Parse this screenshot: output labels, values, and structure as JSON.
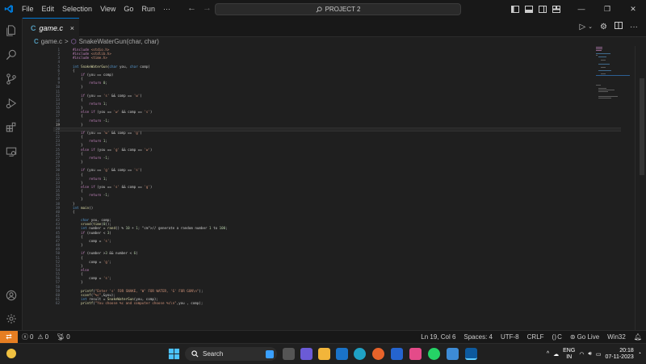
{
  "menu": [
    "File",
    "Edit",
    "Selection",
    "View",
    "Go",
    "Run",
    "···"
  ],
  "search": {
    "label": "PROJECT 2"
  },
  "tab": {
    "filename": "game.c",
    "icon_letter": "C",
    "close": "×"
  },
  "breadcrumb": {
    "file": "game.c",
    "separator": ">",
    "symbol": "SnakeWaterGun(char, char)"
  },
  "code_lines": [
    {
      "n": "1",
      "t": "#include <stdio.h>"
    },
    {
      "n": "2",
      "t": "#include <stdlib.h>"
    },
    {
      "n": "3",
      "t": "#include <time.h>"
    },
    {
      "n": "4",
      "t": ""
    },
    {
      "n": "5",
      "t": "int SnakeWaterGun(char you, char comp)"
    },
    {
      "n": "6",
      "t": "{"
    },
    {
      "n": "7",
      "t": "    if (you == comp)"
    },
    {
      "n": "8",
      "t": "    {"
    },
    {
      "n": "9",
      "t": "        return 0;"
    },
    {
      "n": "10",
      "t": "    }"
    },
    {
      "n": "11",
      "t": ""
    },
    {
      "n": "12",
      "t": "    if (you == 's' && comp == 'w')"
    },
    {
      "n": "13",
      "t": "    {"
    },
    {
      "n": "14",
      "t": "        return 1;"
    },
    {
      "n": "15",
      "t": "    }"
    },
    {
      "n": "16",
      "t": "    else if (you == 'w' && comp == 's')"
    },
    {
      "n": "17",
      "t": "    {"
    },
    {
      "n": "18",
      "t": "        return -1;"
    },
    {
      "n": "19",
      "t": "    }"
    },
    {
      "n": "20",
      "t": ""
    },
    {
      "n": "21",
      "t": "    if (you == 'w' && comp == 'g')"
    },
    {
      "n": "22",
      "t": "    {"
    },
    {
      "n": "23",
      "t": "        return 1;"
    },
    {
      "n": "24",
      "t": "    }"
    },
    {
      "n": "25",
      "t": "    else if (you == 'g' && comp == 'w')"
    },
    {
      "n": "26",
      "t": "    {"
    },
    {
      "n": "27",
      "t": "        return -1;"
    },
    {
      "n": "28",
      "t": "    }"
    },
    {
      "n": "29",
      "t": ""
    },
    {
      "n": "30",
      "t": "    if (you == 'g' && comp == 's')"
    },
    {
      "n": "31",
      "t": "    {"
    },
    {
      "n": "32",
      "t": "        return 1;"
    },
    {
      "n": "33",
      "t": "    }"
    },
    {
      "n": "34",
      "t": "    else if (you == 's' && comp == 'g')"
    },
    {
      "n": "35",
      "t": "    {"
    },
    {
      "n": "36",
      "t": "        return -1;"
    },
    {
      "n": "37",
      "t": "    }"
    },
    {
      "n": "38",
      "t": "}"
    },
    {
      "n": "39",
      "t": "int main()"
    },
    {
      "n": "40",
      "t": "{"
    },
    {
      "n": "41",
      "t": ""
    },
    {
      "n": "42",
      "t": "    char you, comp;"
    },
    {
      "n": "43",
      "t": "    srand(time(0));"
    },
    {
      "n": "44",
      "t": "    int number = rand() % 10 + 1; // generate a random number 1 to 100;"
    },
    {
      "n": "45",
      "t": "    if (number < 3)"
    },
    {
      "n": "46",
      "t": "    {"
    },
    {
      "n": "47",
      "t": "        comp = 's';"
    },
    {
      "n": "48",
      "t": "    }"
    },
    {
      "n": "49",
      "t": ""
    },
    {
      "n": "50",
      "t": "    if (number >3 && number < 6)"
    },
    {
      "n": "51",
      "t": "    {"
    },
    {
      "n": "52",
      "t": "        comp = 'g';"
    },
    {
      "n": "53",
      "t": "    }"
    },
    {
      "n": "54",
      "t": "    else"
    },
    {
      "n": "55",
      "t": "    {"
    },
    {
      "n": "56",
      "t": "        comp = 's';"
    },
    {
      "n": "57",
      "t": "    }"
    },
    {
      "n": "58",
      "t": ""
    },
    {
      "n": "59",
      "t": "    printf(\"Enter 's' FOR SNAKE, 'W' FOR WATER, 'G' FOR GUN\\n\");"
    },
    {
      "n": "60",
      "t": "    scanf(\"%c\",&you);"
    },
    {
      "n": "61",
      "t": "    int result = SnakeWaterGun(you, comp);"
    },
    {
      "n": "62",
      "t": "    printf(\"You choose %c and computer choose %c\\n\",you , comp);"
    }
  ],
  "current_line": "19",
  "status": {
    "errors": "0",
    "warnings": "0",
    "ports": "0",
    "position": "Ln 19, Col 6",
    "spaces": "Spaces: 4",
    "encoding": "UTF-8",
    "eol": "CRLF",
    "braces": "{ }",
    "language": "C",
    "golive": "Go Live",
    "platform": "Win32"
  },
  "taskbar": {
    "search_label": "Search"
  },
  "tray": {
    "lang1": "ENG",
    "lang2": "IN",
    "time": "20:18",
    "date": "07-11-2023"
  },
  "colors": {
    "accent": "#0078d4",
    "remote": "#e67e22"
  }
}
